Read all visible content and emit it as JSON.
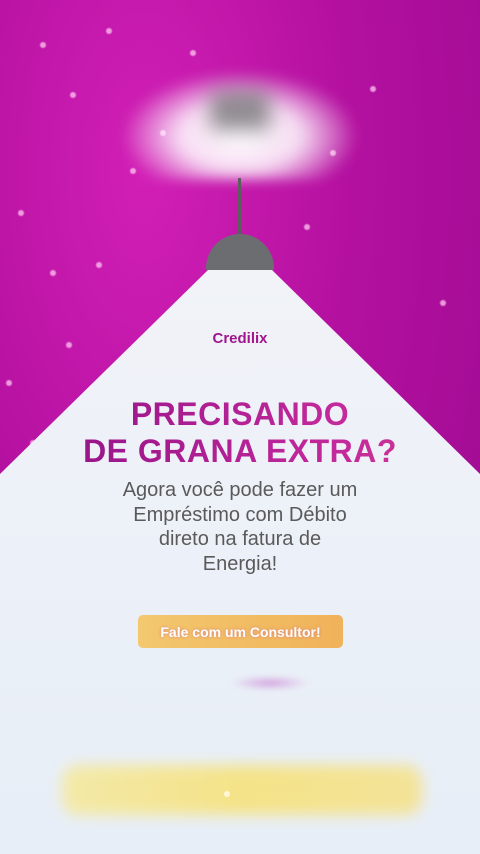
{
  "brand": {
    "name": "Credilix"
  },
  "headline": {
    "line1": "PRECISANDO",
    "line2": "DE GRANA EXTRA?"
  },
  "subtitle": {
    "line1": "Agora você pode fazer um",
    "line2": "Empréstimo com Débito",
    "line3": "direto na fatura de",
    "line4": "Energia!"
  },
  "cta": {
    "label": "Fale com um Consultor!"
  },
  "colors": {
    "background_magenta": "#b3109f",
    "light_cone": "#eef2f8",
    "brand_purple": "#a0168f",
    "cta_gold": "#f2be64"
  }
}
